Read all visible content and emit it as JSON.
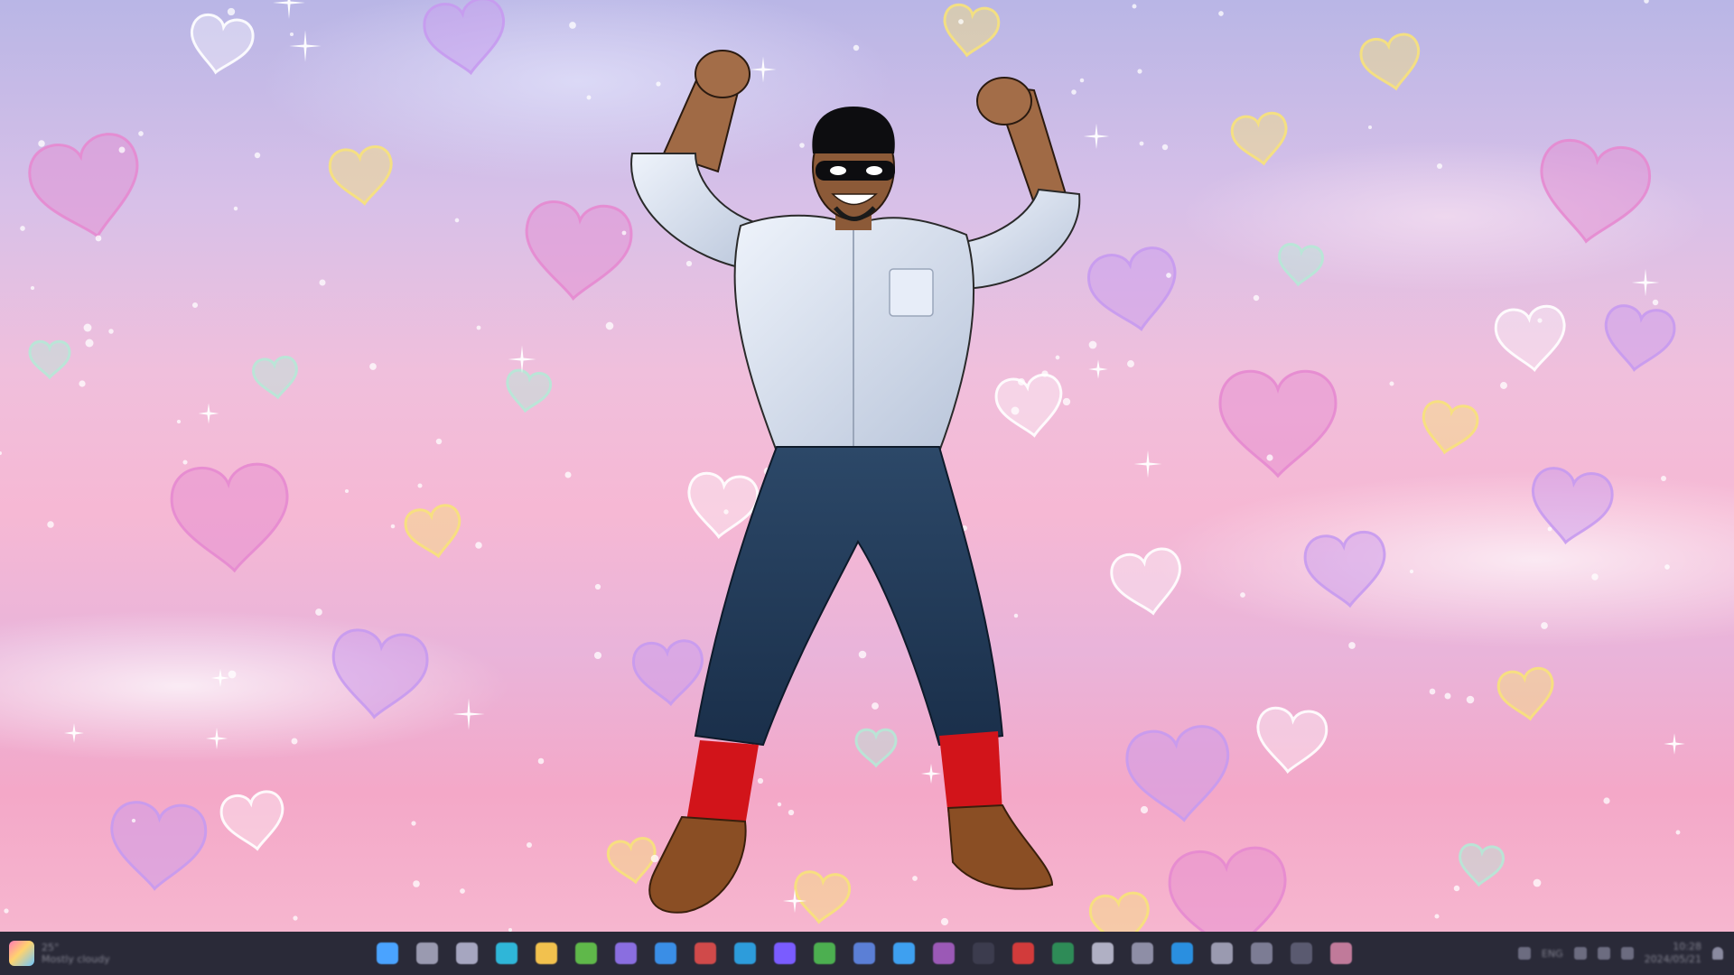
{
  "desktop": {
    "wallpaper": "pastel pink sky with clouds, sparkles and doodle hearts",
    "colors": {
      "sky_top": "#b9b6e6",
      "sky_mid": "#f0bfdc",
      "sky_bottom": "#f6b6cf",
      "heart_pink": "#e58ad0",
      "heart_purple": "#c79af0",
      "heart_yellow": "#f7e27a",
      "heart_white": "#ffffff",
      "heart_mint": "#b6e8d6"
    },
    "character": {
      "description": "muscular figure flexing both arms, black beanie, masked face, light blue shirt, blue jeans, red socks, brown shoes"
    }
  },
  "taskbar": {
    "widget": {
      "line1": "25°",
      "line2": "Mostly cloudy"
    },
    "apps": [
      {
        "name": "start-button",
        "icon": "windows-icon",
        "color": "#4aa3ff"
      },
      {
        "name": "search-button",
        "icon": "search-icon",
        "color": "#9a9ab0"
      },
      {
        "name": "chat-app",
        "icon": "chat-icon",
        "color": "#a6a6c0"
      },
      {
        "name": "edge-app",
        "icon": "edge-icon",
        "color": "#2fb6d8"
      },
      {
        "name": "explorer-app",
        "icon": "folder-icon",
        "color": "#f2c14e"
      },
      {
        "name": "chrome-app",
        "icon": "chrome-icon",
        "color": "#5fb84a"
      },
      {
        "name": "app-7",
        "icon": "app-icon",
        "color": "#8a6ee0"
      },
      {
        "name": "store-app",
        "icon": "store-icon",
        "color": "#3a8ee6"
      },
      {
        "name": "app-9",
        "icon": "app-icon",
        "color": "#d04a4a"
      },
      {
        "name": "app-10",
        "icon": "app-icon",
        "color": "#2d9cdb"
      },
      {
        "name": "app-11",
        "icon": "app-icon",
        "color": "#7a5cff"
      },
      {
        "name": "app-12",
        "icon": "app-icon",
        "color": "#4caf50"
      },
      {
        "name": "app-13",
        "icon": "app-icon",
        "color": "#5b7fd6"
      },
      {
        "name": "app-14",
        "icon": "app-icon",
        "color": "#3ea0f0"
      },
      {
        "name": "app-15",
        "icon": "app-icon",
        "color": "#9b59b6"
      },
      {
        "name": "app-16",
        "icon": "app-icon",
        "color": "#3c3c4e"
      },
      {
        "name": "app-17",
        "icon": "app-icon",
        "color": "#d23b3b"
      },
      {
        "name": "app-18",
        "icon": "app-icon",
        "color": "#2e8b57"
      },
      {
        "name": "app-19",
        "icon": "app-icon",
        "color": "#b0b0c4"
      },
      {
        "name": "app-20",
        "icon": "app-icon",
        "color": "#8e8ea6"
      },
      {
        "name": "vscode-app",
        "icon": "vscode-icon",
        "color": "#2a8fe0"
      },
      {
        "name": "settings-app",
        "icon": "gear-icon",
        "color": "#9a9ab0"
      },
      {
        "name": "app-23",
        "icon": "app-icon",
        "color": "#7c7c94"
      },
      {
        "name": "app-24",
        "icon": "app-icon",
        "color": "#5a5a70"
      },
      {
        "name": "app-25",
        "icon": "app-icon",
        "color": "#c07a9a"
      }
    ],
    "tray": {
      "language": "ENG",
      "time": "10:28",
      "date": "2024/05/21"
    }
  }
}
